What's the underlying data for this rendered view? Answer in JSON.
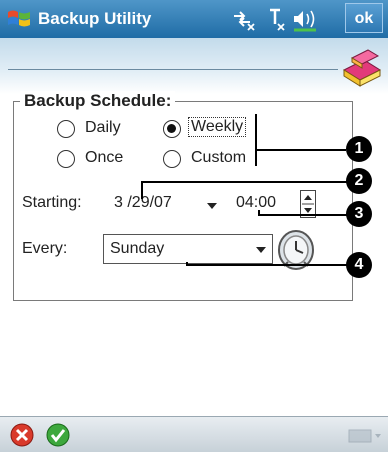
{
  "app": {
    "title": "Backup Utility",
    "ok_label": "ok"
  },
  "schedule": {
    "group_label": "Backup Schedule:",
    "options": [
      {
        "label": "Daily",
        "checked": false
      },
      {
        "label": "Weekly",
        "checked": true
      },
      {
        "label": "Once",
        "checked": false
      },
      {
        "label": "Custom",
        "checked": false
      }
    ],
    "starting_label": "Starting:",
    "date_value": "3 /29/07",
    "time_value": "04:00",
    "every_label": "Every:",
    "every_value": "Sunday"
  },
  "callouts": [
    "1",
    "2",
    "3",
    "4"
  ],
  "icons": {
    "windows": "windows-flag-icon",
    "connectivity": "connectivity-icon",
    "signal": "signal-icon",
    "volume": "volume-icon",
    "header": "backup-books-icon",
    "clock": "clock-icon",
    "cancel": "cancel-icon",
    "accept": "accept-icon",
    "keyboard": "keyboard-icon"
  },
  "colors": {
    "titlebar": "#2a77b1",
    "accent": "#3da83d",
    "cancel": "#d93a2b"
  }
}
